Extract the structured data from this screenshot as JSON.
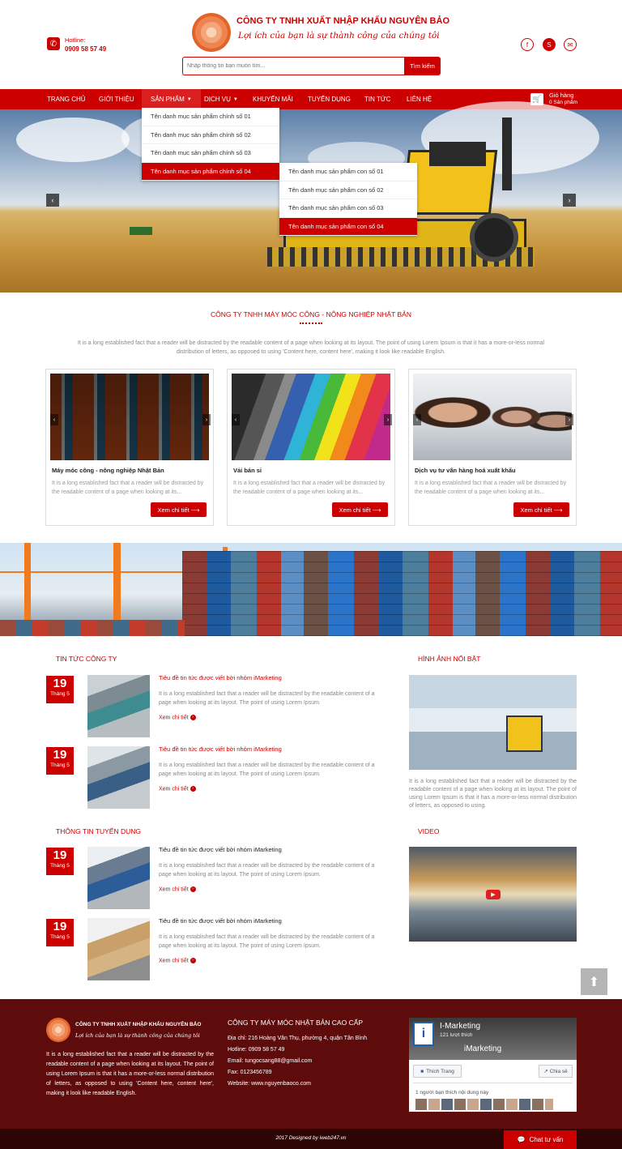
{
  "header": {
    "hotline_label": "Hotline:",
    "hotline_number": "0909 58 57 49",
    "company_name": "CÔNG TY TNHH XUẤT NHẬP KHẨU NGUYÊN BẢO",
    "slogan": "Lợi ích của bạn là sự thành công của chúng tôi",
    "search_placeholder": "Nhập thông tin bạn muốn tìm...",
    "search_button": "Tìm kiếm",
    "social": [
      "f",
      "S",
      "✉"
    ]
  },
  "nav": {
    "items": [
      "TRANG CHỦ",
      "GIỚI THIỆU",
      "SẢN PHẨM",
      "DỊCH VỤ",
      "KHUYẾN MÃI",
      "TUYỂN DỤNG",
      "TIN TỨC",
      "LIÊN HỆ"
    ],
    "cart_title": "Giỏ hàng",
    "cart_count": "0 Sản phẩm"
  },
  "dropdown": {
    "main": [
      "Tên danh mục sản phẩm chính số 01",
      "Tên danh mục sản phẩm chính số 02",
      "Tên danh mục sản phẩm chính số 03",
      "Tên danh mục sản phẩm chính số 04"
    ],
    "sub": [
      "Tên danh mục sản phẩm con số 01",
      "Tên danh mục sản phẩm con số 02",
      "Tên danh mục sản phẩm con số 03",
      "Tên danh mục sản phẩm con số 04"
    ]
  },
  "intro": {
    "title": "CÔNG TY TNHH MÁY MÓC CÔNG - NÔNG NGHIỆP NHẬT BẢN",
    "text": "It is a long established fact that a reader will be distracted by the readable content of a page when looking at its layout. The point of using Lorem Ipsum is that it has a more-or-less normal distribution of letters, as opposed to using 'Content here, content here', making it look like readable English."
  },
  "cards": [
    {
      "title": "Máy móc công - nông nghiệp Nhật Bản",
      "desc": "It is a long established fact that a reader will be distracted by the readable content of a page when looking at its...",
      "button": "Xem chi tiết ⟶"
    },
    {
      "title": "Vải bán sỉ",
      "desc": "It is a long established fact that a reader will be distracted by the readable content of a page when looking at its...",
      "button": "Xem chi tiết ⟶"
    },
    {
      "title": "Dịch vụ tư vấn hàng hoá xuất khẩu",
      "desc": "It is a long established fact that a reader will be distracted by the readable content of a page when looking at its...",
      "button": "Xem chi tiết ⟶"
    }
  ],
  "news": {
    "title": "TIN TỨC CÔNG TY",
    "items": [
      {
        "day": "19",
        "month": "Tháng 5",
        "title": "Tiêu đề tin tức được viết bởi nhóm iMarketing",
        "desc": "It is a long established fact that a reader will be distracted by the readable content of a page when looking at its layout. The point of using Lorem Ipsum.",
        "more": "Xem chi tiết"
      },
      {
        "day": "19",
        "month": "Tháng 5",
        "title": "Tiêu đề tin tức được viết bởi nhóm iMarketing",
        "desc": "It is a long established fact that a reader will be distracted by the readable content of a page when looking at its layout. The point of using Lorem Ipsum.",
        "more": "Xem chi tiết"
      }
    ]
  },
  "recruit": {
    "title": "THÔNG TIN TUYỂN DỤNG",
    "items": [
      {
        "day": "19",
        "month": "Tháng 5",
        "title": "Tiêu đề tin tức được viết bởi nhóm iMarketing",
        "desc": "It is a long established fact that a reader will be distracted by the readable content of a page when looking at its layout. The point of using Lorem Ipsum.",
        "more": "Xem chi tiết"
      },
      {
        "day": "19",
        "month": "Tháng 5",
        "title": "Tiêu đề tin tức được viết bởi nhóm iMarketing",
        "desc": "It is a long established fact that a reader will be distracted by the readable content of a page when looking at its layout. The point of using Lorem Ipsum.",
        "more": "Xem chi tiết"
      }
    ]
  },
  "featured": {
    "title": "HÌNH ẢNH NỔI BẬT",
    "text": "It is a long established fact that a reader will be distracted by the readable content of a page when looking at its layout. The point of using Lorem Ipsum is that it has a more-or-less normal distribution of letters, as opposed to using."
  },
  "video": {
    "title": "VIDEO"
  },
  "footer": {
    "company_name": "CÔNG TY TNHH XUẤT NHẬP KHẨU NGUYÊN BẢO",
    "slogan": "Lợi ích của bạn là sự thành công của chúng tôi",
    "about": "It is a long established fact that a reader will be distracted by the readable content of a page when looking at its layout. The point of using Lorem Ipsum is that it has a more-or-less normal distribution of letters, as opposed to using 'Content here, content here', making it look like readable English.",
    "contact_title": "CÔNG TY MÁY MÓC NHẬT BẢN CAO CẤP",
    "address_label": "Địa chỉ:",
    "address": "216 Hoàng Văn Thụ, phường 4, quận Tân Bình",
    "hotline_label": "Hotline:",
    "hotline": "0909 58 57 49",
    "email_label": "Email:",
    "email": "tungocsang88@gmail.com",
    "fax_label": "Fax:",
    "fax": "0123456789",
    "website_label": "Website:",
    "website": "www.nguyenbaoco.com",
    "fb_name": "I-Marketing",
    "fb_likes": "121 lượt thích",
    "fb_brand": "iMarketing",
    "fb_like_btn": "Thích Trang",
    "fb_share_btn": "Chia sẻ",
    "fb_friends": "1 người bạn thích nội dung này",
    "copyright": "2017 Designed by iweb247.vn",
    "chat": "Chat tư vấn"
  },
  "colors": {
    "primary": "#cc0000",
    "footer_bg": "#5e0b0b",
    "footer_bar": "#2d0505"
  }
}
